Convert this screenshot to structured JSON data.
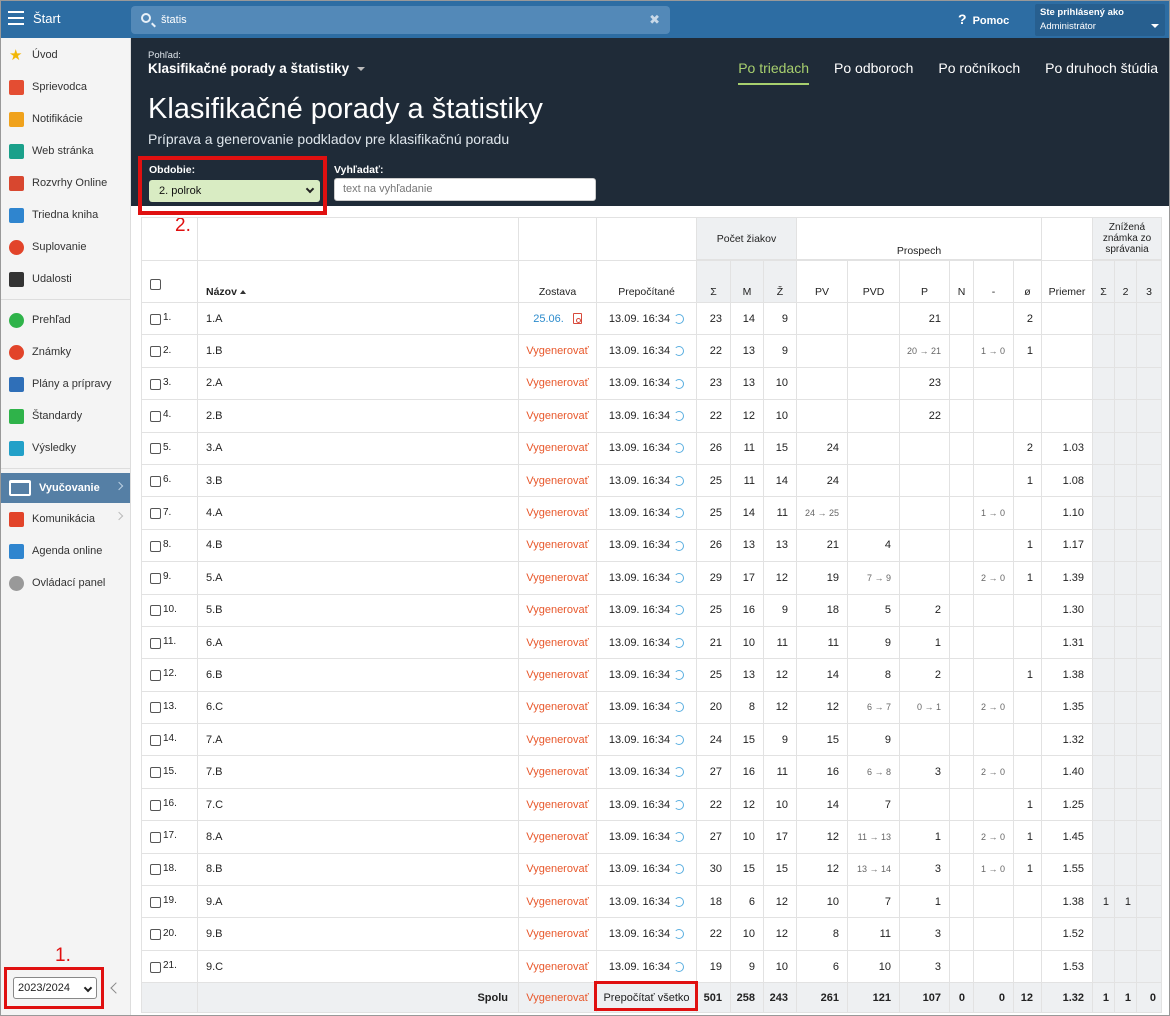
{
  "topbar": {
    "app_title": "Štart",
    "search_value": "štatis",
    "help_label": "Pomoc",
    "user_line1": "Ste prihlásený ako",
    "user_line2": "Administrátor"
  },
  "sidebar": {
    "items": [
      {
        "label": "Úvod",
        "icon": "star-icon",
        "color": "#f2b705"
      },
      {
        "label": "Sprievodca",
        "icon": "runner-icon",
        "color": "#e44d32"
      },
      {
        "label": "Notifikácie",
        "icon": "envelope-icon",
        "color": "#f0a21c"
      },
      {
        "label": "Web stránka",
        "icon": "house-icon",
        "color": "#1aa08a"
      },
      {
        "label": "Rozvrhy Online",
        "icon": "grid-icon",
        "color": "#d8472f"
      },
      {
        "label": "Triedna kniha",
        "icon": "book-icon",
        "color": "#2f85cf"
      },
      {
        "label": "Suplovanie",
        "icon": "user-swap-icon",
        "color": "#e2442a"
      },
      {
        "label": "Udalosti",
        "icon": "calendar-icon",
        "color": "#333333"
      },
      {
        "label": "Prehľad",
        "icon": "check-circle-icon",
        "color": "#2fb34a"
      },
      {
        "label": "Známky",
        "icon": "grade-icon",
        "color": "#e2442a"
      },
      {
        "label": "Plány a prípravy",
        "icon": "briefcase-icon",
        "color": "#2f6fb8"
      },
      {
        "label": "Štandardy",
        "icon": "shield-check-icon",
        "color": "#2fb34a"
      },
      {
        "label": "Výsledky",
        "icon": "bar-chart-icon",
        "color": "#22a0c8"
      },
      {
        "label": "Vyučovanie",
        "icon": "open-book-icon",
        "color": "#ffffff"
      },
      {
        "label": "Komunikácia",
        "icon": "chat-icon",
        "color": "#e2442a"
      },
      {
        "label": "Agenda online",
        "icon": "pen-icon",
        "color": "#2f85cf"
      },
      {
        "label": "Ovládací panel",
        "icon": "gear-icon",
        "color": "#999999"
      }
    ],
    "year": "2023/2024",
    "mark1": "1."
  },
  "header": {
    "view_label": "Pohľad:",
    "view_value": "Klasifikačné porady a štatistiky",
    "tabs": [
      "Po triedach",
      "Po odboroch",
      "Po ročníkoch",
      "Po druhoch štúdia"
    ],
    "title": "Klasifikačné porady a štatistiky",
    "subtitle": "Príprava a generovanie podkladov pre klasifikačnú poradu",
    "period_label": "Obdobie:",
    "period_value": "2. polrok",
    "search_label": "Vyhľadať:",
    "search_placeholder": "text na vyhľadanie",
    "mark2": "2."
  },
  "table": {
    "group_pocet": "Počet žiakov",
    "group_prospech": "Prospech",
    "group_znizena": "Znížená známka zo správania",
    "col_nazov": "Názov",
    "col_zostava": "Zostava",
    "col_prepocitane": "Prepočítané",
    "col_priemer": "Priemer",
    "sub_pocet": [
      "Σ",
      "M",
      "Ž"
    ],
    "sub_prospech": [
      "PV",
      "PVD",
      "P",
      "N",
      "-",
      "ø"
    ],
    "sub_znizena": [
      "Σ",
      "2",
      "3"
    ],
    "gen_label": "Vygenerovať",
    "rows": [
      {
        "i": "1.",
        "name": "1.A",
        "zos": "25.06.",
        "pre": "13.09. 16:34",
        "s": "23",
        "m": "14",
        "z": "9",
        "pv": "",
        "pvd": "",
        "p": "21",
        "n": "",
        "dash": "",
        "o": "2",
        "avg": "",
        "zs": "",
        "z2": ""
      },
      {
        "i": "2.",
        "name": "1.B",
        "zos": "",
        "pre": "13.09. 16:34",
        "s": "22",
        "m": "13",
        "z": "9",
        "pv": "",
        "pvd": "",
        "p": "20 → 21",
        "n": "",
        "dash": "1 → 0",
        "o": "1",
        "avg": "",
        "zs": "",
        "z2": ""
      },
      {
        "i": "3.",
        "name": "2.A",
        "zos": "",
        "pre": "13.09. 16:34",
        "s": "23",
        "m": "13",
        "z": "10",
        "pv": "",
        "pvd": "",
        "p": "23",
        "n": "",
        "dash": "",
        "o": "",
        "avg": "",
        "zs": "",
        "z2": ""
      },
      {
        "i": "4.",
        "name": "2.B",
        "zos": "",
        "pre": "13.09. 16:34",
        "s": "22",
        "m": "12",
        "z": "10",
        "pv": "",
        "pvd": "",
        "p": "22",
        "n": "",
        "dash": "",
        "o": "",
        "avg": "",
        "zs": "",
        "z2": ""
      },
      {
        "i": "5.",
        "name": "3.A",
        "zos": "",
        "pre": "13.09. 16:34",
        "s": "26",
        "m": "11",
        "z": "15",
        "pv": "24",
        "pvd": "",
        "p": "",
        "n": "",
        "dash": "",
        "o": "2",
        "avg": "1.03",
        "zs": "",
        "z2": ""
      },
      {
        "i": "6.",
        "name": "3.B",
        "zos": "",
        "pre": "13.09. 16:34",
        "s": "25",
        "m": "11",
        "z": "14",
        "pv": "24",
        "pvd": "",
        "p": "",
        "n": "",
        "dash": "",
        "o": "1",
        "avg": "1.08",
        "zs": "",
        "z2": ""
      },
      {
        "i": "7.",
        "name": "4.A",
        "zos": "",
        "pre": "13.09. 16:34",
        "s": "25",
        "m": "14",
        "z": "11",
        "pv": "24 → 25",
        "pvd": "",
        "p": "",
        "n": "",
        "dash": "1 → 0",
        "o": "",
        "avg": "1.10",
        "zs": "",
        "z2": ""
      },
      {
        "i": "8.",
        "name": "4.B",
        "zos": "",
        "pre": "13.09. 16:34",
        "s": "26",
        "m": "13",
        "z": "13",
        "pv": "21",
        "pvd": "4",
        "p": "",
        "n": "",
        "dash": "",
        "o": "1",
        "avg": "1.17",
        "zs": "",
        "z2": ""
      },
      {
        "i": "9.",
        "name": "5.A",
        "zos": "",
        "pre": "13.09. 16:34",
        "s": "29",
        "m": "17",
        "z": "12",
        "pv": "19",
        "pvd": "7 → 9",
        "p": "",
        "n": "",
        "dash": "2 → 0",
        "o": "1",
        "avg": "1.39",
        "zs": "",
        "z2": ""
      },
      {
        "i": "10.",
        "name": "5.B",
        "zos": "",
        "pre": "13.09. 16:34",
        "s": "25",
        "m": "16",
        "z": "9",
        "pv": "18",
        "pvd": "5",
        "p": "2",
        "n": "",
        "dash": "",
        "o": "",
        "avg": "1.30",
        "zs": "",
        "z2": ""
      },
      {
        "i": "11.",
        "name": "6.A",
        "zos": "",
        "pre": "13.09. 16:34",
        "s": "21",
        "m": "10",
        "z": "11",
        "pv": "11",
        "pvd": "9",
        "p": "1",
        "n": "",
        "dash": "",
        "o": "",
        "avg": "1.31",
        "zs": "",
        "z2": ""
      },
      {
        "i": "12.",
        "name": "6.B",
        "zos": "",
        "pre": "13.09. 16:34",
        "s": "25",
        "m": "13",
        "z": "12",
        "pv": "14",
        "pvd": "8",
        "p": "2",
        "n": "",
        "dash": "",
        "o": "1",
        "avg": "1.38",
        "zs": "",
        "z2": ""
      },
      {
        "i": "13.",
        "name": "6.C",
        "zos": "",
        "pre": "13.09. 16:34",
        "s": "20",
        "m": "8",
        "z": "12",
        "pv": "12",
        "pvd": "6 → 7",
        "p": "0 → 1",
        "n": "",
        "dash": "2 → 0",
        "o": "",
        "avg": "1.35",
        "zs": "",
        "z2": ""
      },
      {
        "i": "14.",
        "name": "7.A",
        "zos": "",
        "pre": "13.09. 16:34",
        "s": "24",
        "m": "15",
        "z": "9",
        "pv": "15",
        "pvd": "9",
        "p": "",
        "n": "",
        "dash": "",
        "o": "",
        "avg": "1.32",
        "zs": "",
        "z2": ""
      },
      {
        "i": "15.",
        "name": "7.B",
        "zos": "",
        "pre": "13.09. 16:34",
        "s": "27",
        "m": "16",
        "z": "11",
        "pv": "16",
        "pvd": "6 → 8",
        "p": "3",
        "n": "",
        "dash": "2 → 0",
        "o": "",
        "avg": "1.40",
        "zs": "",
        "z2": ""
      },
      {
        "i": "16.",
        "name": "7.C",
        "zos": "",
        "pre": "13.09. 16:34",
        "s": "22",
        "m": "12",
        "z": "10",
        "pv": "14",
        "pvd": "7",
        "p": "",
        "n": "",
        "dash": "",
        "o": "1",
        "avg": "1.25",
        "zs": "",
        "z2": ""
      },
      {
        "i": "17.",
        "name": "8.A",
        "zos": "",
        "pre": "13.09. 16:34",
        "s": "27",
        "m": "10",
        "z": "17",
        "pv": "12",
        "pvd": "11 → 13",
        "p": "1",
        "n": "",
        "dash": "2 → 0",
        "o": "1",
        "avg": "1.45",
        "zs": "",
        "z2": ""
      },
      {
        "i": "18.",
        "name": "8.B",
        "zos": "",
        "pre": "13.09. 16:34",
        "s": "30",
        "m": "15",
        "z": "15",
        "pv": "12",
        "pvd": "13 → 14",
        "p": "3",
        "n": "",
        "dash": "1 → 0",
        "o": "1",
        "avg": "1.55",
        "zs": "",
        "z2": ""
      },
      {
        "i": "19.",
        "name": "9.A",
        "zos": "",
        "pre": "13.09. 16:34",
        "s": "18",
        "m": "6",
        "z": "12",
        "pv": "10",
        "pvd": "7",
        "p": "1",
        "n": "",
        "dash": "",
        "o": "",
        "avg": "1.38",
        "zs": "1",
        "z2": "1"
      },
      {
        "i": "20.",
        "name": "9.B",
        "zos": "",
        "pre": "13.09. 16:34",
        "s": "22",
        "m": "10",
        "z": "12",
        "pv": "8",
        "pvd": "11",
        "p": "3",
        "n": "",
        "dash": "",
        "o": "",
        "avg": "1.52",
        "zs": "",
        "z2": ""
      },
      {
        "i": "21.",
        "name": "9.C",
        "zos": "",
        "pre": "13.09. 16:34",
        "s": "19",
        "m": "9",
        "z": "10",
        "pv": "6",
        "pvd": "10",
        "p": "3",
        "n": "",
        "dash": "",
        "o": "",
        "avg": "1.53",
        "zs": "",
        "z2": ""
      }
    ],
    "footer": {
      "label": "Spolu",
      "gen": "Vygenerovať",
      "recalc": "Prepočítať všetko",
      "s": "501",
      "m": "258",
      "z": "243",
      "pv": "261",
      "pvd": "121",
      "p": "107",
      "n": "0",
      "dash": "0",
      "o": "12",
      "avg": "1.32",
      "zs": "1",
      "z2": "1",
      "z3": "0"
    }
  }
}
